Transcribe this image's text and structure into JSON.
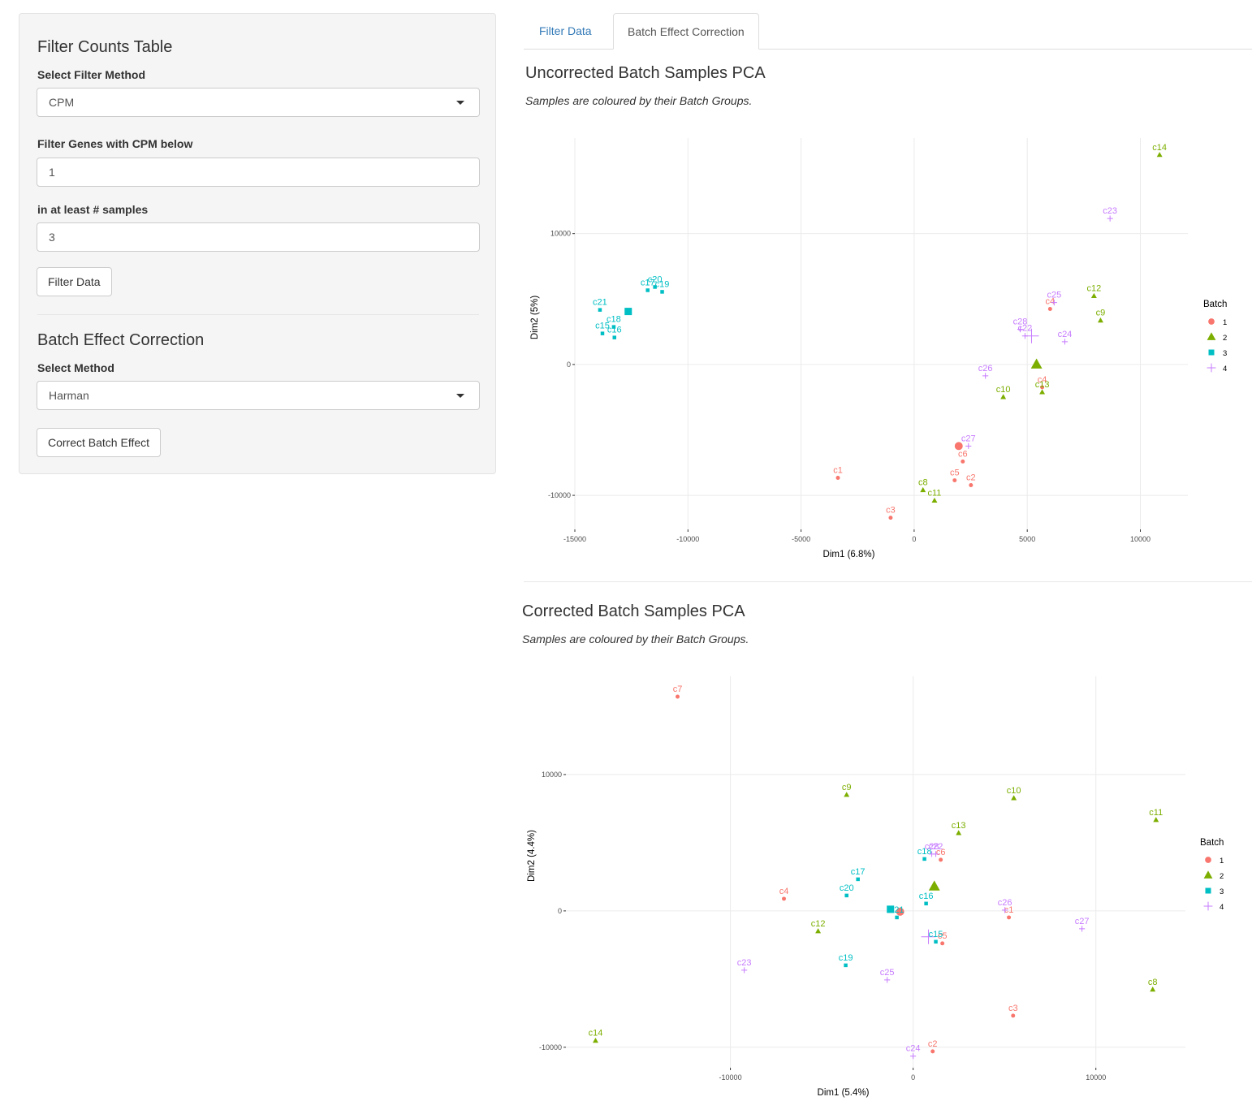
{
  "sidebar": {
    "filter_heading": "Filter Counts Table",
    "filter_method_label": "Select Filter Method",
    "filter_method_value": "CPM",
    "cpm_label": "Filter Genes with CPM below",
    "cpm_value": "1",
    "samples_label": "in at least # samples",
    "samples_value": "3",
    "filter_button": "Filter Data",
    "batch_heading": "Batch Effect Correction",
    "method_label": "Select Method",
    "method_value": "Harman",
    "correct_button": "Correct Batch Effect"
  },
  "tabs": [
    {
      "label": "Filter Data",
      "active": false
    },
    {
      "label": "Batch Effect Correction",
      "active": true
    }
  ],
  "sections": [
    {
      "title": "Uncorrected Batch Samples PCA",
      "subtitle": "Samples are coloured by their Batch Groups."
    },
    {
      "title": "Corrected Batch Samples PCA",
      "subtitle": "Samples are coloured by their Batch Groups."
    }
  ],
  "batch_colors": {
    "1": "#F8766D",
    "2": "#7CAE00",
    "3": "#00BFC4",
    "4": "#C77CFF"
  },
  "chart_data": [
    {
      "type": "scatter",
      "title": "Uncorrected Batch Samples PCA",
      "xlabel": "Dim1 (6.8%)",
      "ylabel": "Dim2 (5%)",
      "xlim": [
        -15000,
        12100
      ],
      "ylim": [
        -12600,
        17300
      ],
      "xticks": [
        -15000,
        -10000,
        -5000,
        0,
        5000,
        10000
      ],
      "yticks": [
        -10000,
        0,
        10000
      ],
      "grid": true,
      "legend": {
        "title": "Batch",
        "entries": [
          "1",
          "2",
          "3",
          "4"
        ],
        "position": "right"
      },
      "points": [
        {
          "label": "c1",
          "batch": "1",
          "x": -3370,
          "y": -8660
        },
        {
          "label": "c2",
          "batch": "1",
          "x": 2510,
          "y": -9220
        },
        {
          "label": "c3",
          "batch": "1",
          "x": -1040,
          "y": -11710
        },
        {
          "label": "c4",
          "batch": "1",
          "x": 6010,
          "y": 4240
        },
        {
          "label": "c4",
          "batch": "1",
          "x": 5660,
          "y": -1740
        },
        {
          "label": "c5",
          "batch": "1",
          "x": 1790,
          "y": -8850
        },
        {
          "label": "c6",
          "batch": "1",
          "x": 2150,
          "y": -7410
        },
        {
          "label": "c8",
          "batch": "2",
          "x": 390,
          "y": -9600
        },
        {
          "label": "c9",
          "batch": "2",
          "x": 8240,
          "y": 3360
        },
        {
          "label": "c10",
          "batch": "2",
          "x": 3940,
          "y": -2490
        },
        {
          "label": "c11",
          "batch": "2",
          "x": 900,
          "y": -10400
        },
        {
          "label": "c12",
          "batch": "2",
          "x": 7950,
          "y": 5230
        },
        {
          "label": "c13",
          "batch": "2",
          "x": 5660,
          "y": -2120
        },
        {
          "label": "c14",
          "batch": "2",
          "x": 10850,
          "y": 16010
        },
        {
          "label": "c15",
          "batch": "3",
          "x": -13780,
          "y": 2370
        },
        {
          "label": "c16",
          "batch": "3",
          "x": -13250,
          "y": 2060
        },
        {
          "label": "c17",
          "batch": "3",
          "x": -11780,
          "y": 5670
        },
        {
          "label": "c18",
          "batch": "3",
          "x": -13280,
          "y": 2870
        },
        {
          "label": "c19",
          "batch": "3",
          "x": -11140,
          "y": 5550
        },
        {
          "label": "c20",
          "batch": "3",
          "x": -11460,
          "y": 5920
        },
        {
          "label": "c21",
          "batch": "3",
          "x": -13890,
          "y": 4170
        },
        {
          "label": "c22",
          "batch": "4",
          "x": 4900,
          "y": 2180
        },
        {
          "label": "c23",
          "batch": "4",
          "x": 8660,
          "y": 11150
        },
        {
          "label": "c24",
          "batch": "4",
          "x": 6660,
          "y": 1740
        },
        {
          "label": "c25",
          "batch": "4",
          "x": 6190,
          "y": 4730
        },
        {
          "label": "c26",
          "batch": "4",
          "x": 3150,
          "y": -870
        },
        {
          "label": "c27",
          "batch": "4",
          "x": 2400,
          "y": -6230
        },
        {
          "label": "c28",
          "batch": "4",
          "x": 4690,
          "y": 2680
        }
      ],
      "centroids": [
        {
          "batch": "1",
          "x": 1970,
          "y": -6230
        },
        {
          "batch": "2",
          "x": 5410,
          "y": 0
        },
        {
          "batch": "3",
          "x": -12640,
          "y": 4050
        },
        {
          "batch": "4",
          "x": 5190,
          "y": 2180
        }
      ]
    },
    {
      "type": "scatter",
      "title": "Corrected Batch Samples PCA",
      "xlabel": "Dim1 (5.4%)",
      "ylabel": "Dim2 (4.4%)",
      "xlim": [
        -19000,
        14900
      ],
      "ylim": [
        -11500,
        17200
      ],
      "xticks": [
        -10000,
        0,
        10000
      ],
      "yticks": [
        -10000,
        0,
        10000
      ],
      "grid": true,
      "legend": {
        "title": "Batch",
        "entries": [
          "1",
          "2",
          "3",
          "4"
        ],
        "position": "right"
      },
      "points": [
        {
          "label": "c1",
          "batch": "1",
          "x": 5240,
          "y": -480
        },
        {
          "label": "c2",
          "batch": "1",
          "x": 1070,
          "y": -10300
        },
        {
          "label": "c3",
          "batch": "1",
          "x": 5470,
          "y": -7680
        },
        {
          "label": "c4",
          "batch": "1",
          "x": -7070,
          "y": 890
        },
        {
          "label": "c5",
          "batch": "1",
          "x": 1600,
          "y": -2380
        },
        {
          "label": "c6",
          "batch": "1",
          "x": 1510,
          "y": 3750
        },
        {
          "label": "c7",
          "batch": "1",
          "x": -12890,
          "y": 15710
        },
        {
          "label": "c8",
          "batch": "2",
          "x": 13110,
          "y": -5770
        },
        {
          "label": "c9",
          "batch": "2",
          "x": -3640,
          "y": 8510
        },
        {
          "label": "c10",
          "batch": "2",
          "x": 5510,
          "y": 8270
        },
        {
          "label": "c11",
          "batch": "2",
          "x": 13290,
          "y": 6670
        },
        {
          "label": "c12",
          "batch": "2",
          "x": -5200,
          "y": -1490
        },
        {
          "label": "c13",
          "batch": "2",
          "x": 2490,
          "y": 5710
        },
        {
          "label": "c14",
          "batch": "2",
          "x": -17380,
          "y": -9520
        },
        {
          "label": "c15",
          "batch": "3",
          "x": 1240,
          "y": -2260
        },
        {
          "label": "c16",
          "batch": "3",
          "x": 710,
          "y": 540
        },
        {
          "label": "c17",
          "batch": "3",
          "x": -3020,
          "y": 2320
        },
        {
          "label": "c18",
          "batch": "3",
          "x": 620,
          "y": 3810
        },
        {
          "label": "c19",
          "batch": "3",
          "x": -3690,
          "y": -3990
        },
        {
          "label": "c20",
          "batch": "3",
          "x": -3640,
          "y": 1130
        },
        {
          "label": "c21",
          "batch": "3",
          "x": -890,
          "y": -480
        },
        {
          "label": "c22",
          "batch": "4",
          "x": 1240,
          "y": 4170
        },
        {
          "label": "c23",
          "batch": "4",
          "x": -9240,
          "y": -4350
        },
        {
          "label": "c24",
          "batch": "4",
          "x": 0,
          "y": -10650
        },
        {
          "label": "c25",
          "batch": "4",
          "x": -1420,
          "y": -5060
        },
        {
          "label": "c26",
          "batch": "4",
          "x": 5020,
          "y": 60
        },
        {
          "label": "c27",
          "batch": "4",
          "x": 9240,
          "y": -1310
        },
        {
          "label": "c28",
          "batch": "4",
          "x": 1020,
          "y": 4170
        }
      ],
      "centroids": [
        {
          "batch": "1",
          "x": -710,
          "y": -60
        },
        {
          "batch": "2",
          "x": 1160,
          "y": 1790
        },
        {
          "batch": "3",
          "x": -1240,
          "y": 120
        },
        {
          "batch": "4",
          "x": 840,
          "y": -1900
        }
      ]
    }
  ]
}
